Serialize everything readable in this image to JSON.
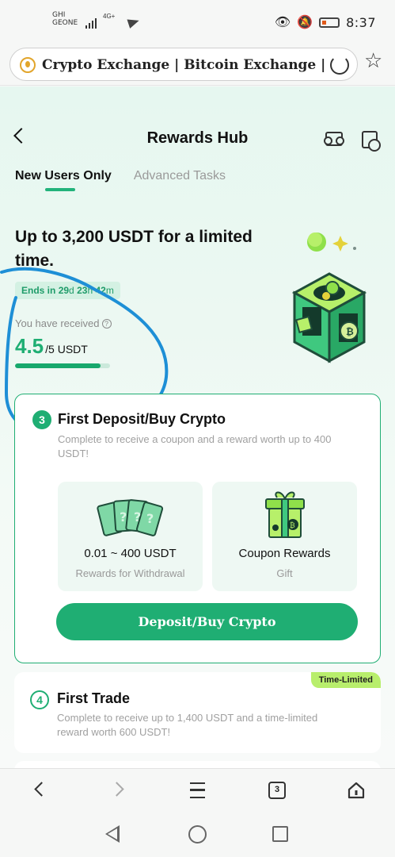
{
  "status_bar": {
    "carrier_line1": "GHI",
    "carrier_line2": "GEONE",
    "network": "4G+",
    "time": "8:37"
  },
  "browser": {
    "url_text": "Crypto Exchange | Bitcoin Exchange | Bitcoin Tr",
    "nav_tab_count": "3"
  },
  "header": {
    "title": "Rewards Hub"
  },
  "tabs": [
    {
      "label": "New Users Only",
      "active": true
    },
    {
      "label": "Advanced Tasks",
      "active": false
    }
  ],
  "promo": {
    "headline": "Up to 3,200 USDT for a limited time.",
    "ends_prefix": "Ends in",
    "ends_days": "29",
    "ends_d_unit": "d",
    "ends_hours": "23",
    "ends_h_unit": "h",
    "ends_minutes": "42",
    "ends_m_unit": "m",
    "received_label": "You have received",
    "received_amount": "4.5",
    "received_total": "/5 USDT",
    "progress_fraction": 0.9
  },
  "tasks": [
    {
      "step": "3",
      "title": "First Deposit/Buy Crypto",
      "description": "Complete to receive a coupon and a reward worth up to 400 USDT!",
      "rewards": [
        {
          "value": "0.01 ~ 400 USDT",
          "subtitle": "Rewards for Withdrawal",
          "icon": "question-cards-icon"
        },
        {
          "value": "Coupon Rewards",
          "subtitle": "Gift",
          "icon": "gift-box-icon"
        }
      ],
      "button_label": "Deposit/Buy Crypto"
    },
    {
      "step": "4",
      "title": "First Trade",
      "description": "Complete to receive up to 1,400 USDT and a time-limited reward worth 600 USDT!",
      "badge": "Time-Limited"
    }
  ],
  "colors": {
    "accent": "#1fae73",
    "badge": "#b8ee6c",
    "annotation": "#1e8fd6"
  }
}
